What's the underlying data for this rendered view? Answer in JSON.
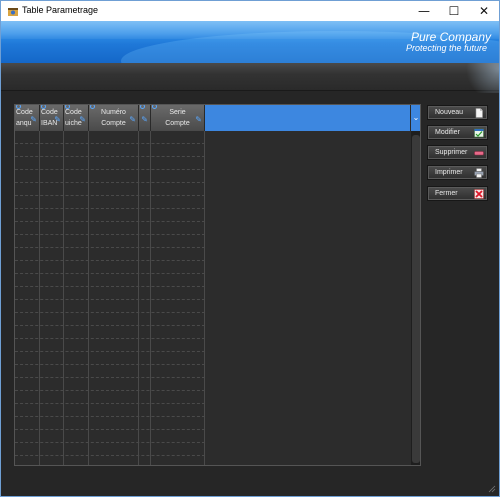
{
  "window": {
    "title": "Table Parametrage",
    "controls": {
      "minimize": "—",
      "maximize": "☐",
      "close": "✕"
    }
  },
  "banner": {
    "company": "Pure Company",
    "tagline": "Protecting the future"
  },
  "grid": {
    "columns": [
      {
        "line1": "Code",
        "line2": "anqu"
      },
      {
        "line1": "Code",
        "line2": "IBAN"
      },
      {
        "line1": "Code",
        "line2": "uiche"
      },
      {
        "line1": "Numéro",
        "line2": "Compte"
      },
      {
        "line1": "",
        "line2": ""
      },
      {
        "line1": "Serie",
        "line2": "Compte"
      }
    ],
    "scroll_icon": "double-chevron-down-icon"
  },
  "actions": {
    "nouveau": "Nouveau",
    "modifier": "Modifier",
    "supprimer": "Supprimer",
    "imprimer": "Imprimer",
    "fermer": "Fermer"
  },
  "colors": {
    "accent": "#3d87e0",
    "banner": "#1f78d8",
    "background": "#262626"
  }
}
